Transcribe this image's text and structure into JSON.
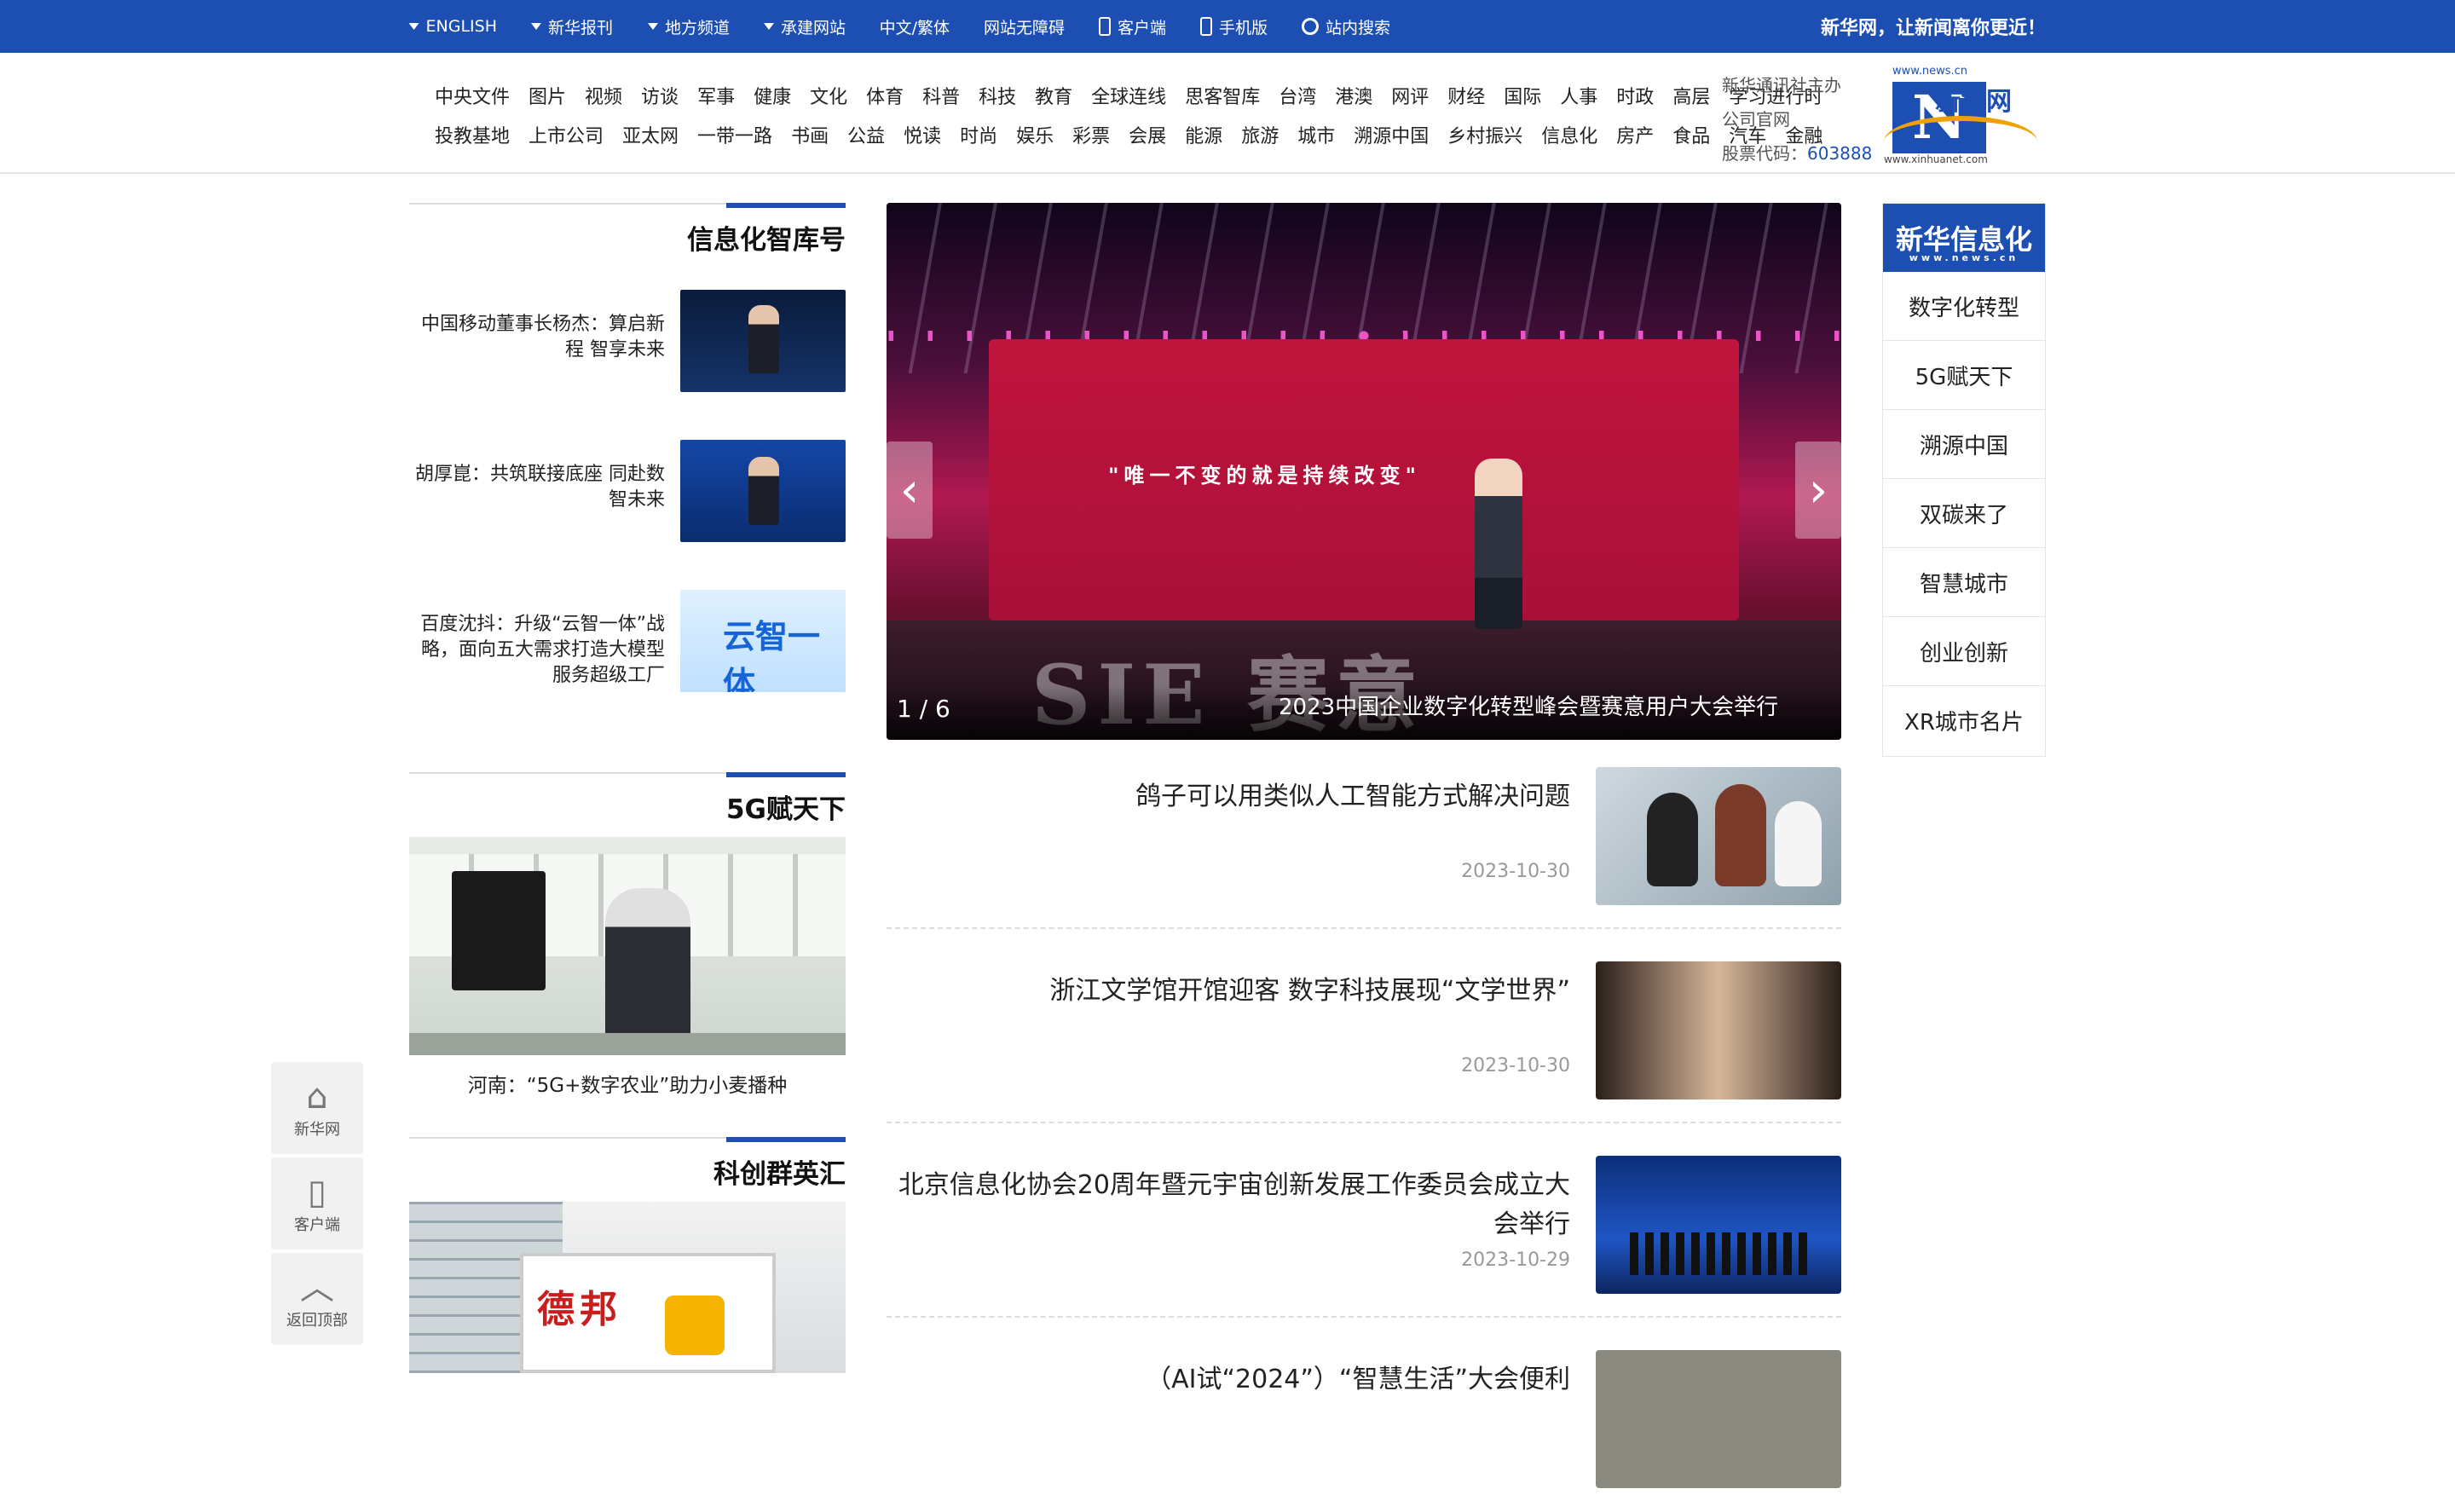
{
  "topbar": {
    "slogan": "新华网，让新闻离你更近！",
    "links": [
      {
        "label": "ENGLISH",
        "caret": true
      },
      {
        "label": "新华报刊",
        "caret": true
      },
      {
        "label": "地方频道",
        "caret": true
      },
      {
        "label": "承建网站",
        "caret": true
      },
      {
        "label": "中文/繁体",
        "caret": false
      },
      {
        "label": "网站无障碍",
        "caret": false
      },
      {
        "label": "客户端",
        "icon": "phone-icon"
      },
      {
        "label": "手机版",
        "icon": "mobile-icon"
      },
      {
        "label": "站内搜索",
        "icon": "search-icon"
      }
    ]
  },
  "header": {
    "logo_cn": "新华网",
    "logo_url": "www.news.cn",
    "logo_url2": "www.xinhuanet.com",
    "host_line1": "新华通讯社主办",
    "host_line2": "公司官网",
    "stock_label": "股票代码：",
    "stock_code": "603888",
    "nav_row1": [
      "学习进行时",
      "高层",
      "时政",
      "人事",
      "国际",
      "财经",
      "网评",
      "港澳",
      "台湾",
      "思客智库",
      "全球连线",
      "教育",
      "科技",
      "科普",
      "体育",
      "文化",
      "健康",
      "军事",
      "访谈",
      "视频",
      "图片",
      "中央文件"
    ],
    "nav_row2": [
      "金融",
      "汽车",
      "食品",
      "房产",
      "信息化",
      "乡村振兴",
      "溯源中国",
      "城市",
      "旅游",
      "能源",
      "会展",
      "彩票",
      "娱乐",
      "时尚",
      "悦读",
      "公益",
      "书画",
      "一带一路",
      "亚太网",
      "上市公司",
      "投教基地"
    ]
  },
  "sidebar": {
    "head": "新华信息化",
    "head_sub": "www.news.cn",
    "items": [
      "数字化转型",
      "5G赋天下",
      "溯源中国",
      "双碳来了",
      "智慧城市",
      "创业创新",
      "XR城市名片"
    ]
  },
  "carousel": {
    "caption": "2023中国企业数字化转型峰会暨赛意用户大会举行",
    "pager": "1 / 6",
    "banner_text": "\"唯一不变的就是持续改变\"",
    "brand": "SIE 赛意",
    "prev_icon": "chevron-left-icon",
    "next_icon": "chevron-right-icon"
  },
  "news": [
    {
      "title": "鸽子可以用类似人工智能方式解决问题",
      "date": "2023-10-30"
    },
    {
      "title": "浙江文学馆开馆迎客 数字科技展现“文学世界”",
      "date": "2023-10-30"
    },
    {
      "title": "北京信息化协会20周年暨元宇宙创新发展工作委员会成立大会举行",
      "date": "2023-10-29"
    },
    {
      "title": "（AI试“2024”）“智慧生活”大会便利",
      "date": ""
    }
  ],
  "sections": {
    "think_tank": {
      "title": "信息化智库号",
      "items": [
        "中国移动董事长杨杰：算启新程 智享未来",
        "胡厚崑：共筑联接底座 同赴数智未来",
        "百度沈抖：升级“云智一体”战略，面向五大需求打造大模型服务超级工厂"
      ]
    },
    "fiveg": {
      "title": "5G赋天下",
      "caption": "河南：“5G+数字农业”助力小麦播种"
    },
    "kcb": {
      "title": "科创群英汇"
    }
  },
  "tools": [
    {
      "label": "新华网",
      "icon": "home-icon"
    },
    {
      "label": "客户端",
      "icon": "phone-icon"
    },
    {
      "label": "返回顶部",
      "icon": "chevron-up-icon"
    }
  ]
}
